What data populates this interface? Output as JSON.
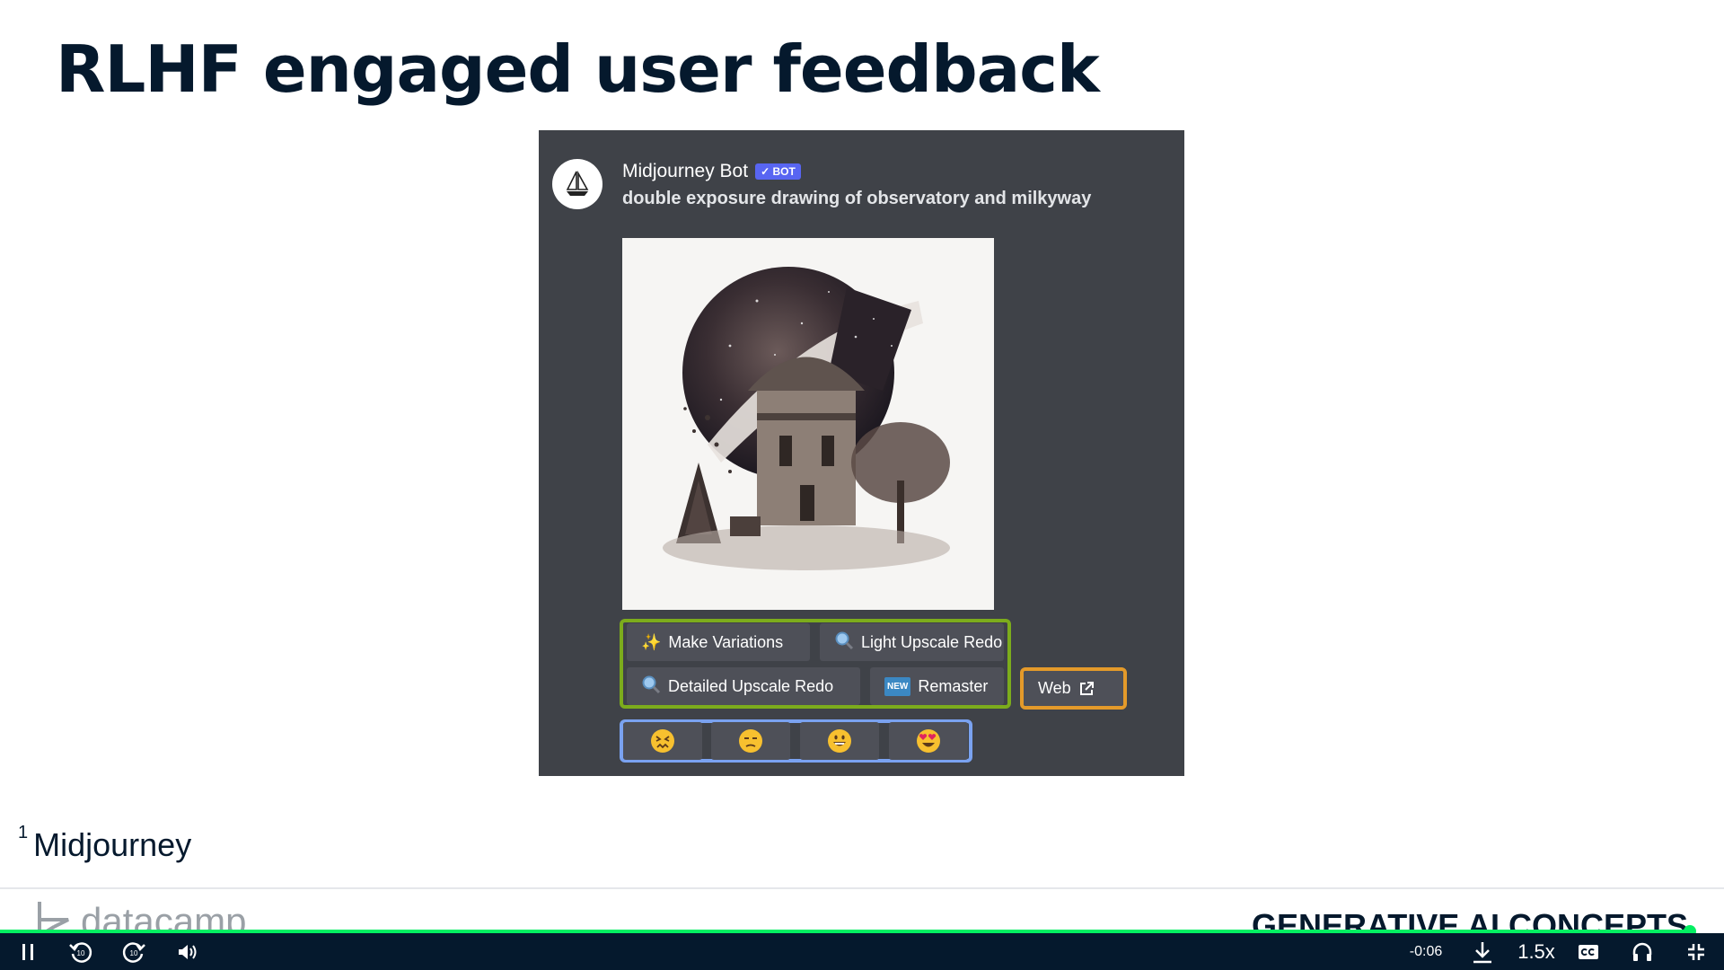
{
  "slide": {
    "title": "RLHF engaged user feedback"
  },
  "discord": {
    "bot_name": "Midjourney Bot",
    "bot_badge": "✓ BOT",
    "prompt": "double exposure drawing of observatory and milkyway",
    "buttons": {
      "make_variations": "Make Variations",
      "light_upscale_redo": "Light Upscale Redo",
      "detailed_upscale_redo": "Detailed Upscale Redo",
      "remaster": "Remaster",
      "remaster_icon_text": "NEW",
      "web": "Web"
    },
    "reactions": [
      "confounded-face-emoji",
      "unamused-face-emoji",
      "grinning-face-emoji",
      "heart-eyes-emoji"
    ],
    "highlight_colors": {
      "green": "#7cac1c",
      "blue": "#7aa2f0",
      "orange": "#e49a2a"
    }
  },
  "footnote": {
    "number": "1",
    "text": "Midjourney"
  },
  "footer": {
    "brand": "datacamp",
    "course": "GENERATIVE AI CONCEPTS"
  },
  "player": {
    "time_remaining": "-0:06",
    "speed": "1.5x",
    "progress": 0.98,
    "accent": "#03ef62"
  }
}
